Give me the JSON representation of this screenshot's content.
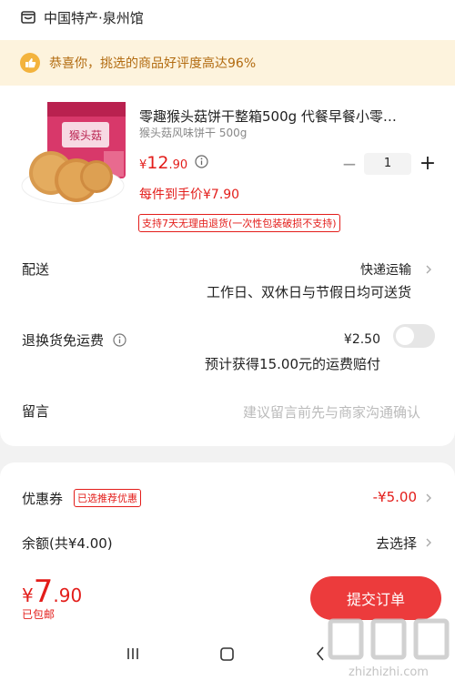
{
  "shop": {
    "name": "中国特产·泉州馆",
    "icon": "shop-icon"
  },
  "banner": {
    "icon": "thumbs-up-icon",
    "text": "恭喜你，挑选的商品好评度高达96%"
  },
  "product": {
    "image_text": "猴头菇",
    "title": "零趣猴头菇饼干整箱500g 代餐早餐小零…",
    "spec": "猴头菇风味饼干 500g",
    "price_symbol": "¥",
    "price_int": "12",
    "price_dec": ".90",
    "unit_price_text": "每件到手价¥7.90",
    "quantity": "1",
    "minus_label": "−",
    "plus_label": "+",
    "return_policy": "支持7天无理由退货(一次性包装破损不支持)"
  },
  "delivery": {
    "label": "配送",
    "method": "快递运输",
    "note": "工作日、双休日与节假日均可送货"
  },
  "return_shipping": {
    "label": "退换货免运费",
    "price": "¥2.50",
    "note": "预计获得15.00元的运费赔付",
    "enabled": false
  },
  "message": {
    "label": "留言",
    "placeholder": "建议留言前先与商家沟通确认"
  },
  "coupon": {
    "label": "优惠券",
    "badge": "已选推荐优惠",
    "value": "-¥5.00"
  },
  "balance": {
    "label": "余额(共¥4.00)",
    "action": "去选择"
  },
  "footer": {
    "total_symbol": "¥",
    "total_int": "7",
    "total_dec": ".90",
    "shipping": "已包邮",
    "submit_label": "提交订单"
  },
  "colors": {
    "accent": "#e31d1a",
    "button": "#ec3b3c",
    "banner_bg": "#fdf3dd",
    "banner_text": "#b26b10"
  }
}
